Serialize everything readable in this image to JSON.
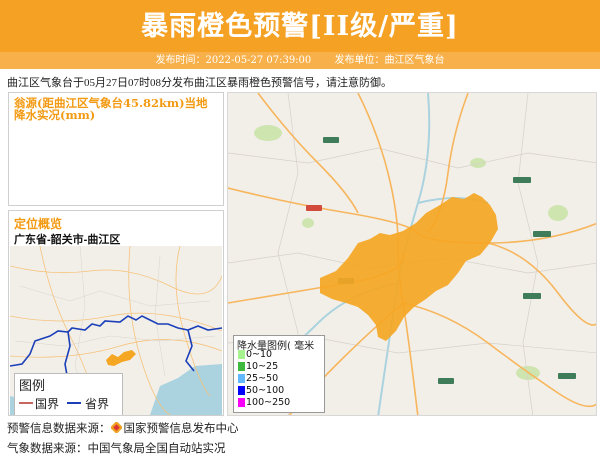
{
  "header": {
    "title": "暴雨橙色预警[II级/严重]",
    "publish_time_label": "发布时间：2022-05-27 07:39:00",
    "publish_unit_label": "发布单位：曲江区气象台"
  },
  "notice": "曲江区气象台于05月27日07时08分发布曲江区暴雨橙色预警信号，请注意防御。",
  "rain_panel": {
    "title": "翁源(距曲江区气象台45.82km)当地降水实况(mm)"
  },
  "location_panel": {
    "title": "定位概览",
    "path": "广东省-韶关市-曲江区"
  },
  "map_legend": {
    "title": "图例",
    "national_border": "国界",
    "provincial_border": "省界",
    "colors": {
      "national": "#c7665f",
      "provincial": "#1b3fb8"
    }
  },
  "rain_legend": {
    "title": "降水量图例( 毫米",
    "items": [
      {
        "label": "0~10",
        "color": "#a6f28f"
      },
      {
        "label": "10~25",
        "color": "#3dba3d"
      },
      {
        "label": "25~50",
        "color": "#61b8ff"
      },
      {
        "label": "50~100",
        "color": "#0000fe"
      },
      {
        "label": "100~250",
        "color": "#fa00fa"
      }
    ]
  },
  "footer": {
    "warning_source": "预警信息数据来源：",
    "warning_source_name": "国家预警信息发布中心",
    "weather_source": "气象数据来源：中国气象局全国自动站实况"
  },
  "colors": {
    "header_bg": "#f5a124",
    "subbar_bg": "#f8b04a",
    "accent_text": "#f39a13",
    "warning_area": "#f5a623"
  }
}
